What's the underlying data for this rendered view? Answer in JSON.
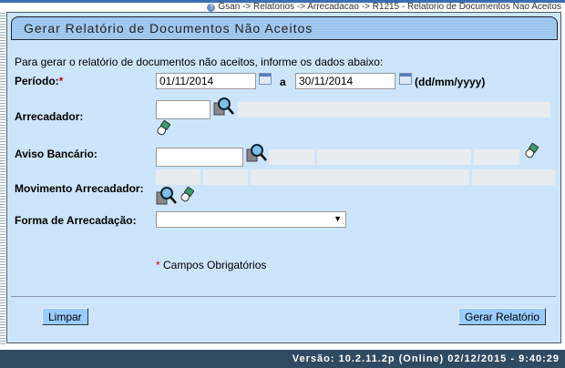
{
  "breadcrumb": "Gsan -> Relatorios -> Arrecadacao -> R1215 - Relatorio de Documentos Nao Aceitos",
  "title": "Gerar Relatório de Documentos Não Aceitos",
  "intro": "Para gerar o relatório de documentos não aceitos, informe os dados abaixo:",
  "periodo": {
    "label": "Período:",
    "required": "*",
    "start": "01/11/2014",
    "sep": "a",
    "end": "30/11/2014",
    "format": "(dd/mm/yyyy)"
  },
  "arrecadador": {
    "label": "Arrecadador:",
    "value": ""
  },
  "aviso": {
    "label": "Aviso Bancário:",
    "value": ""
  },
  "movimento": {
    "label": "Movimento Arrecadador:"
  },
  "forma": {
    "label": "Forma de Arrecadação:",
    "value": ""
  },
  "required_note": {
    "star": "*",
    "text": " Campos Obrigatórios"
  },
  "buttons": {
    "clear": "Limpar",
    "generate": "Gerar Relatório"
  },
  "footer": "Versão: 10.2.11.2p (Online) 02/12/2015 - 9:40:29",
  "colors": {
    "panel": "#cce5fb",
    "button": "#99ccff",
    "footer": "#2f4a63",
    "required": "#cc0000"
  }
}
